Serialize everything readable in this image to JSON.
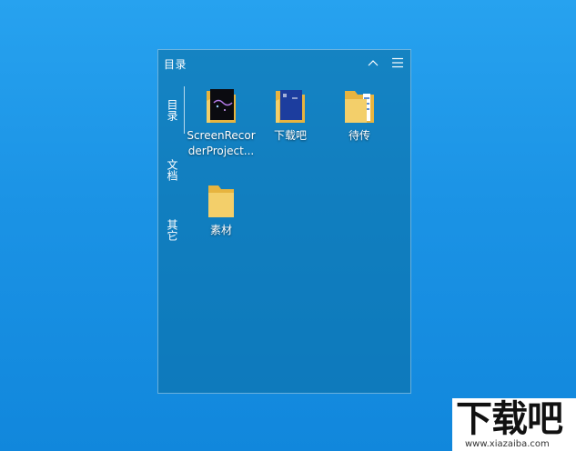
{
  "panel": {
    "title": "目录",
    "icons": {
      "collapse": "chevron-up-icon",
      "menu": "hamburger-menu-icon"
    }
  },
  "tabs": [
    {
      "label": "目录"
    },
    {
      "label": "文档"
    },
    {
      "label": "其它"
    }
  ],
  "items": [
    {
      "label": "ScreenRecorderProject...",
      "icon": "folder-icon"
    },
    {
      "label": "下载吧",
      "icon": "folder-icon"
    },
    {
      "label": "待传",
      "icon": "folder-icon"
    },
    {
      "label": "素材",
      "icon": "folder-icon"
    }
  ],
  "watermark": {
    "logo": "下载吧",
    "url": "www.xiazaiba.com"
  },
  "colors": {
    "desktop": "#1b93e5",
    "panel": "#0a6ea0",
    "folder": "#f3cf6a"
  }
}
